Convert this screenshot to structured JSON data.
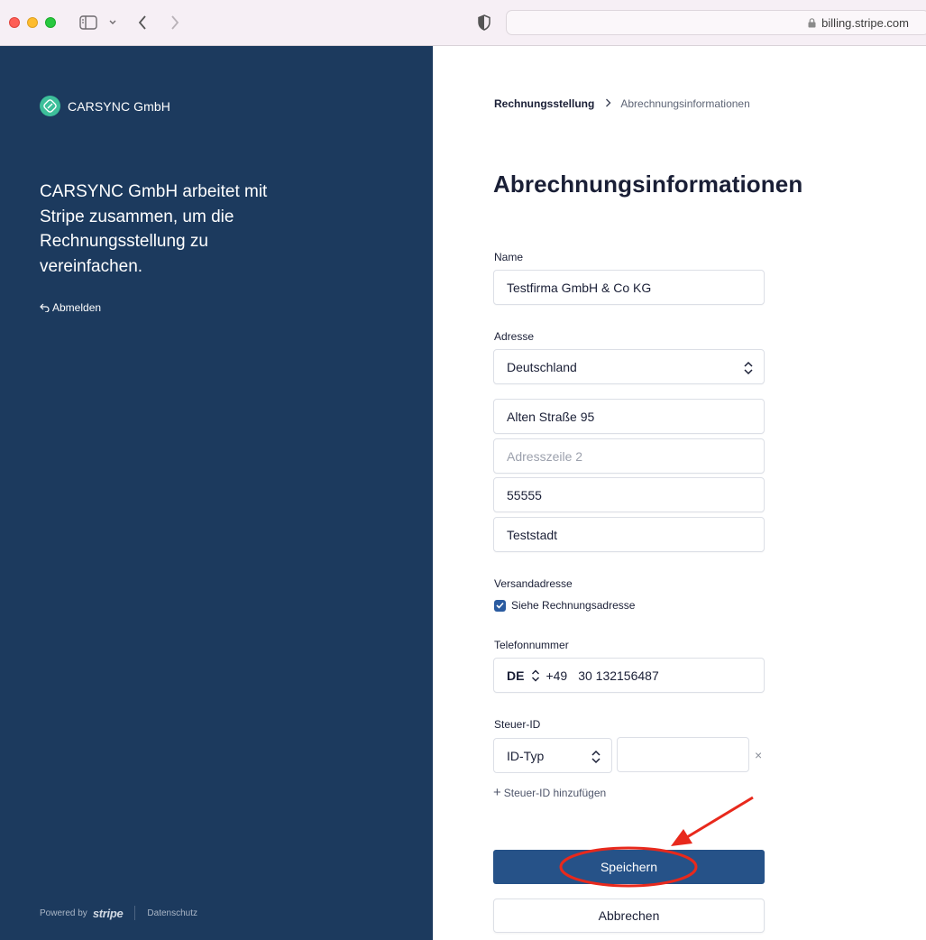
{
  "browser": {
    "url": "billing.stripe.com"
  },
  "merchant": {
    "name": "CARSYNC GmbH",
    "tagline": "CARSYNC GmbH arbeitet mit Stripe zusammen, um die Rechnungsstellung zu vereinfachen.",
    "logout_label": "Abmelden"
  },
  "footer": {
    "powered_by": "Powered by",
    "stripe": "stripe",
    "privacy": "Datenschutz"
  },
  "breadcrumb": {
    "parent": "Rechnungsstellung",
    "current": "Abrechnungsinformationen"
  },
  "page_title": "Abrechnungsinformationen",
  "form": {
    "name_label": "Name",
    "name_value": "Testfirma GmbH & Co KG",
    "address_label": "Adresse",
    "country": "Deutschland",
    "line1": "Alten Straße 95",
    "line2_placeholder": "Adresszeile 2",
    "postal_code": "55555",
    "city": "Teststadt",
    "shipping_label": "Versandadresse",
    "shipping_same_label": "Siehe Rechnungsadresse",
    "shipping_same_checked": true,
    "phone_label": "Telefonnummer",
    "phone_country": "DE",
    "phone_prefix": "+49",
    "phone_number": "30 132156487",
    "tax_label": "Steuer-ID",
    "tax_type_placeholder": "ID-Typ",
    "tax_value": "",
    "remove_symbol": "×",
    "add_tax_id": "Steuer-ID hinzufügen"
  },
  "actions": {
    "save": "Speichern",
    "cancel": "Abbrechen"
  },
  "colors": {
    "sidebar_bg": "#1c3a5e",
    "primary_button": "#265288",
    "annotation": "#e8291c",
    "brand_logo": "#3dbf9a"
  }
}
